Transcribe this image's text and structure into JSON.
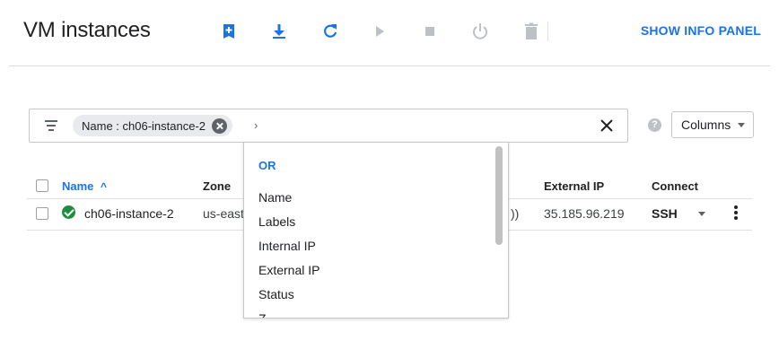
{
  "header": {
    "title": "VM instances",
    "show_info_panel": "SHOW INFO PANEL",
    "toolbar": [
      {
        "icon": "create-instance-icon",
        "enabled": true
      },
      {
        "icon": "import-vm-icon",
        "enabled": true
      },
      {
        "icon": "refresh-icon",
        "enabled": true
      },
      {
        "icon": "start-icon",
        "enabled": false
      },
      {
        "icon": "stop-icon",
        "enabled": false
      },
      {
        "icon": "reset-icon",
        "enabled": false
      },
      {
        "icon": "delete-icon",
        "enabled": false
      }
    ]
  },
  "filter": {
    "chip_label": "Name : ch06-instance-2",
    "separator": "›",
    "clear_icon": "close-icon"
  },
  "columns_button": "Columns",
  "help_icon_text": "?",
  "table": {
    "headers": {
      "name": "Name",
      "sort_indicator": "^",
      "zone": "Zone",
      "external_ip": "External IP",
      "connect": "Connect"
    },
    "rows": [
      {
        "status": "running",
        "name": "ch06-instance-2",
        "zone": "us-east",
        "internal_ip_tail": "))",
        "external_ip": "35.185.96.219",
        "connect": "SSH"
      }
    ]
  },
  "dropdown": {
    "heading": "OR",
    "items": [
      "Name",
      "Labels",
      "Internal IP",
      "External IP",
      "Status",
      "Z"
    ]
  },
  "colors": {
    "accent": "#1a73e8",
    "status_ok": "#1e8e3e",
    "disabled_icon": "#bdc1c6"
  }
}
